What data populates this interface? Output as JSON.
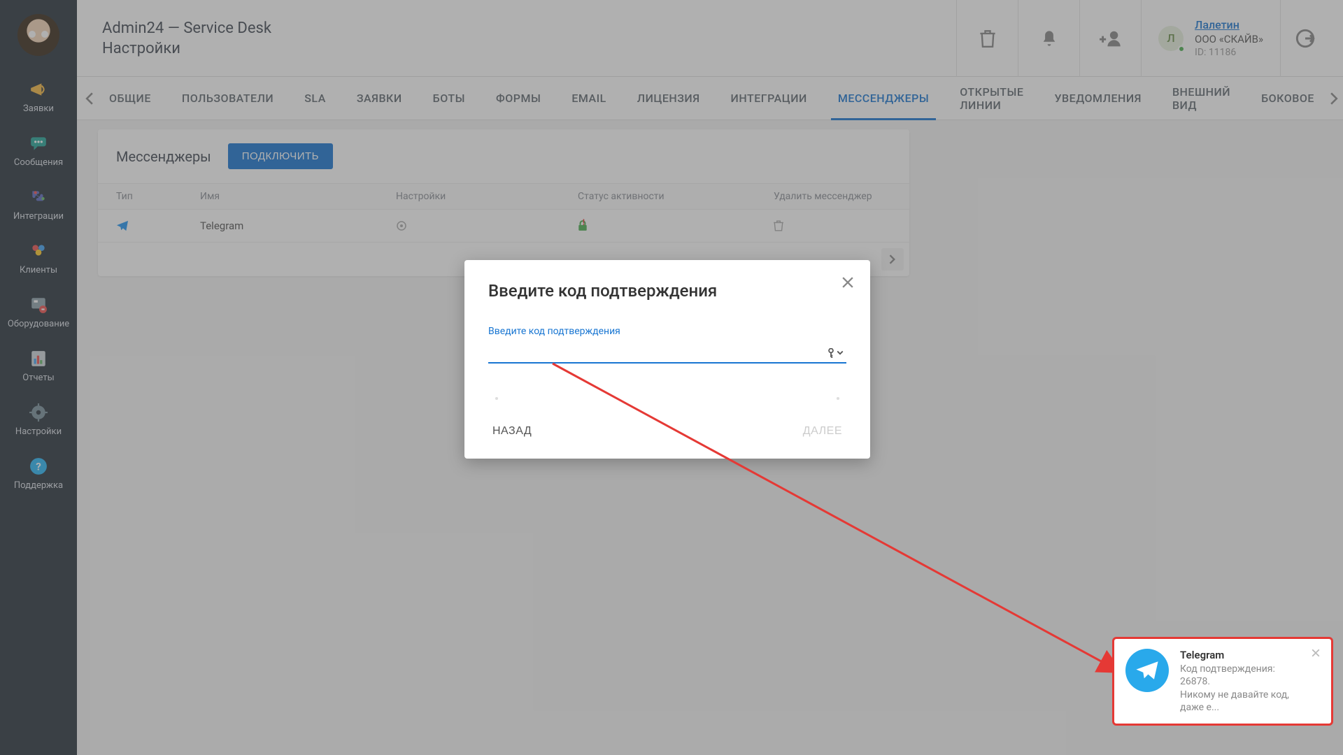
{
  "header": {
    "title": "Admin24 — Service Desk",
    "subtitle": "Настройки"
  },
  "user": {
    "initial": "Л",
    "name": "Лалетин",
    "org": "ООО «СКАЙВ»",
    "id_label": "ID: 11186"
  },
  "sidebar": [
    {
      "label": "Заявки"
    },
    {
      "label": "Сообщения"
    },
    {
      "label": "Интеграции"
    },
    {
      "label": "Клиенты"
    },
    {
      "label": "Оборудование"
    },
    {
      "label": "Отчеты"
    },
    {
      "label": "Настройки"
    },
    {
      "label": "Поддержка"
    }
  ],
  "tabs": [
    "ОБЩИЕ",
    "ПОЛЬЗОВАТЕЛИ",
    "SLA",
    "ЗАЯВКИ",
    "БОТЫ",
    "ФОРМЫ",
    "EMAIL",
    "ЛИЦЕНЗИЯ",
    "ИНТЕГРАЦИИ",
    "МЕССЕНДЖЕРЫ",
    "ОТКРЫТЫЕ ЛИНИИ",
    "УВЕДОМЛЕНИЯ",
    "ВНЕШНИЙ ВИД",
    "БОКОВОЕ"
  ],
  "active_tab_index": 9,
  "panel": {
    "title": "Мессенджеры",
    "connect_btn": "ПОДКЛЮЧИТЬ",
    "columns": [
      "Тип",
      "Имя",
      "Настройки",
      "Статус активности",
      "Удалить мессенджер"
    ],
    "rows": [
      {
        "name": "Telegram"
      }
    ]
  },
  "dialog": {
    "title": "Введите код подтверждения",
    "field_label": "Введите код подтверждения",
    "field_value": "",
    "back": "НАЗАД",
    "next": "ДАЛЕЕ"
  },
  "toast": {
    "title": "Telegram",
    "line1_prefix": "Код подтверждения: ",
    "code": "26878",
    "line1_suffix": ".",
    "line2": "Никому не давайте код, даже е..."
  }
}
